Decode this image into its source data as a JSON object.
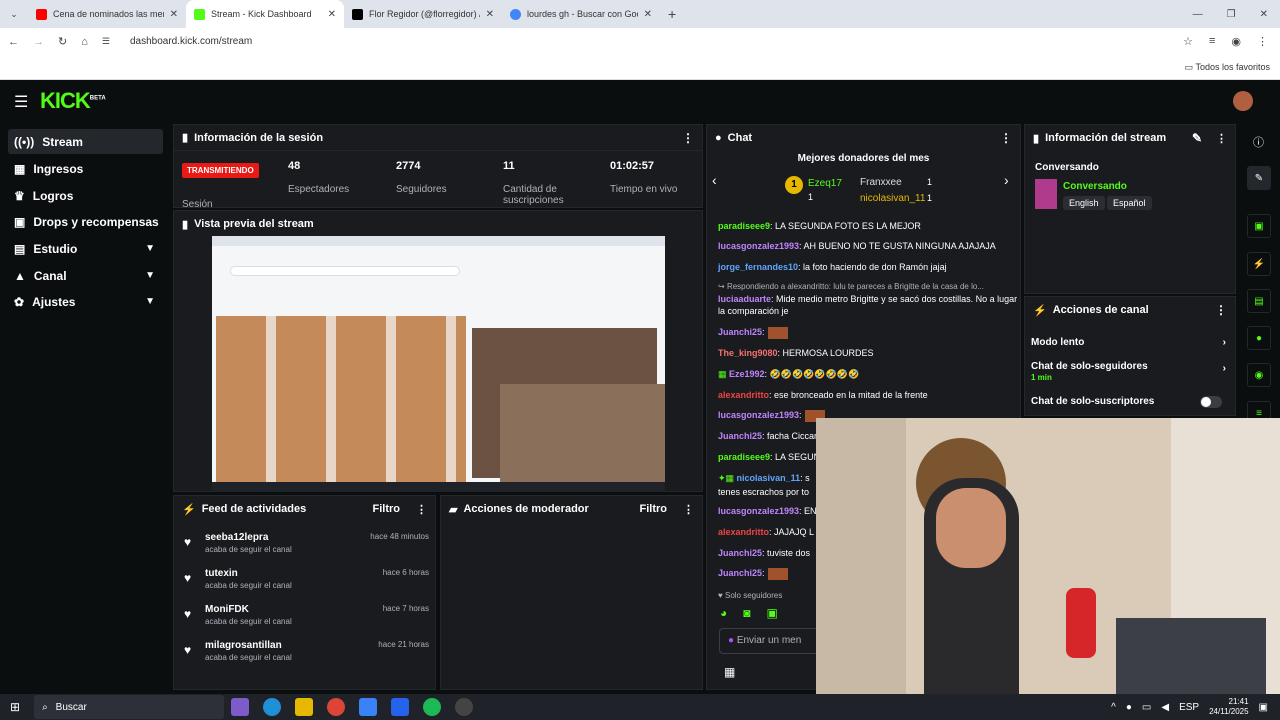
{
  "browser": {
    "tabs": [
      {
        "title": "Cena de nominados las menti",
        "color": "#ff0000"
      },
      {
        "title": "Stream - Kick Dashboard",
        "color": "#53fc18"
      },
      {
        "title": "Flor Regidor (@florregidor) / X",
        "color": "#000000"
      },
      {
        "title": "lourdes gh - Buscar con Google",
        "color": "#4285f4"
      }
    ],
    "url": "dashboard.kick.com/stream",
    "favorites_label": "Todos los favoritos"
  },
  "brand": {
    "logo": "KICK",
    "beta": "BETA",
    "accent": "#53fc18"
  },
  "sidebar": {
    "items": [
      {
        "label": "Stream",
        "icon": "radio-icon"
      },
      {
        "label": "Ingresos",
        "icon": "grid-icon"
      },
      {
        "label": "Logros",
        "icon": "trophy-icon"
      },
      {
        "label": "Drops y recompensas",
        "icon": "gift-icon"
      },
      {
        "label": "Estudio",
        "icon": "studio-icon"
      },
      {
        "label": "Canal",
        "icon": "person-icon"
      },
      {
        "label": "Ajustes",
        "icon": "gear-icon"
      }
    ]
  },
  "session": {
    "title": "Información de la sesión",
    "live_badge": "TRANSMITIENDO",
    "session_label": "Sesión",
    "stats": [
      {
        "value": "48",
        "label": "Espectadores"
      },
      {
        "value": "2774",
        "label": "Seguidores"
      },
      {
        "value": "11",
        "label": "Cantidad de suscripciones"
      },
      {
        "value": "01:02:57",
        "label": "Tiempo en vivo"
      }
    ]
  },
  "preview": {
    "title": "Vista previa del stream"
  },
  "feed": {
    "title": "Feed de actividades",
    "filter": "Filtro",
    "items": [
      {
        "name": "seeba12lepra",
        "action": "acaba de seguir el canal",
        "time": "hace 48 minutos"
      },
      {
        "name": "tutexin",
        "action": "acaba de seguir el canal",
        "time": "hace 6 horas"
      },
      {
        "name": "MoniFDK",
        "action": "acaba de seguir el canal",
        "time": "hace 7 horas"
      },
      {
        "name": "milagrosantillan",
        "action": "acaba de seguir el canal",
        "time": "hace 21 horas"
      }
    ]
  },
  "mod": {
    "title": "Acciones de moderador",
    "filter": "Filtro"
  },
  "chat": {
    "title": "Chat",
    "donors_title": "Mejores donadores del mes",
    "donors": [
      {
        "name": "Ezeq17",
        "count": "1"
      },
      {
        "name": "Franxxee",
        "count": "1"
      },
      {
        "name": "nicolasivan_11",
        "count": "1"
      }
    ],
    "lines": [
      {
        "user": "paradiseee9",
        "text": ": LA SEGUNDA FOTO ES LA MEJOR",
        "color": "#53fc18"
      },
      {
        "user": "lucasgonzalez1993",
        "text": ": AH BUENO NO TE GUSTA NINGUNA AJAJAJA",
        "color": "#c084fc"
      },
      {
        "user": "jorge_fernandes10",
        "text": ": la foto haciendo de don Ramón jajaj",
        "color": "#60a5fa"
      },
      {
        "user": "",
        "text": "Respondiendo a alexandritto: lulu te pareces a Brigitte de la casa de lo...",
        "color": "#aeb2b8"
      },
      {
        "user": "luciaaduarte",
        "text": ": Mide medio metro Brigitte y se sacó dos costillas. No a lugar la comparación je",
        "color": "#c084fc"
      },
      {
        "user": "Juanchi25",
        "text": ":",
        "color": "#c084fc"
      },
      {
        "user": "The_king9080",
        "text": ": HERMOSA LOURDES",
        "color": "#f87171"
      },
      {
        "user": "Eze1992",
        "text": ": 🤣🤣🤣🤣🤣🤣🤣🤣",
        "color": "#c084fc"
      },
      {
        "user": "alexandritto",
        "text": ": ese bronceado en la mitad de la frente",
        "color": "#ef4444"
      },
      {
        "user": "lucasgonzalez1993",
        "text": ":",
        "color": "#c084fc"
      },
      {
        "user": "Juanchi25",
        "text": ": facha Ciccar",
        "color": "#c084fc"
      },
      {
        "user": "paradiseee9",
        "text": ": LA SEGUN",
        "color": "#53fc18"
      },
      {
        "user": "nicolasivan_11",
        "text": ": s",
        "color": "#60a5fa"
      },
      {
        "user": "",
        "text": "tenes escrachos por to",
        "color": "#ffffff"
      },
      {
        "user": "lucasgonzalez1993",
        "text": ": EN",
        "color": "#c084fc"
      },
      {
        "user": "alexandritto",
        "text": ": JAJAJQ L",
        "color": "#ef4444"
      },
      {
        "user": "Juanchi25",
        "text": ": tuviste dos",
        "color": "#c084fc"
      },
      {
        "user": "Juanchi25",
        "text": ":",
        "color": "#c084fc"
      }
    ],
    "followers_only": "Solo seguidores",
    "input_placeholder": "Enviar un men"
  },
  "stream_info": {
    "title": "Información del stream",
    "category_label": "Conversando",
    "category": "Conversando",
    "tags": [
      "English",
      "Español"
    ]
  },
  "channel_actions": {
    "title": "Acciones de canal",
    "items": [
      {
        "label": "Modo lento",
        "sub": ""
      },
      {
        "label": "Chat de solo-seguidores",
        "sub": "1 min"
      },
      {
        "label": "Chat de solo-suscriptores",
        "sub": ""
      }
    ]
  },
  "taskbar": {
    "search": "Buscar",
    "lang": "ESP",
    "time": "21:41",
    "date": "24/11/2025"
  }
}
